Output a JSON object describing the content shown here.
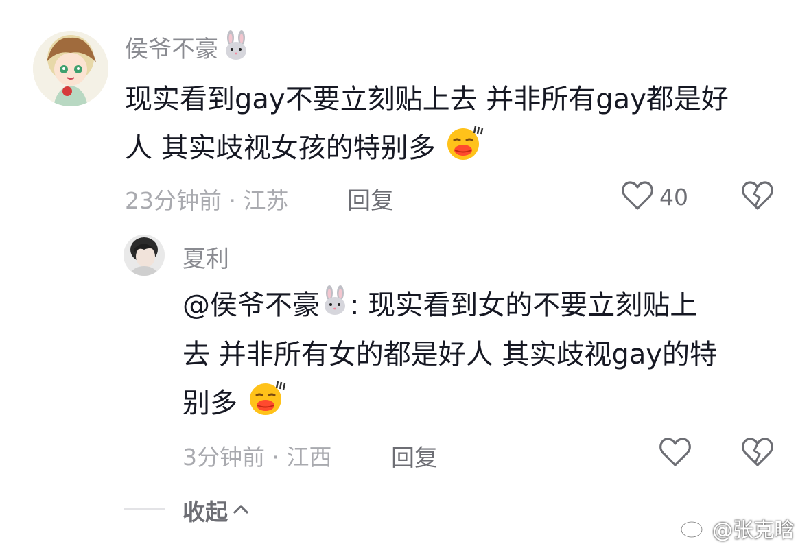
{
  "comment": {
    "username": "侯爷不豪",
    "username_emoji": "rabbit-emoji",
    "text_line1": "现实看到gay不要立刻贴上去 并非所有gay都是好",
    "text_line2": "人 其实歧视女孩的特别多",
    "text_emoji": "smirk-kiss-emoji",
    "time_location": "23分钟前 · 江苏",
    "reply_label": "回复",
    "like_count": "40"
  },
  "reply": {
    "username": "夏利",
    "mention": "@侯爷不豪",
    "mention_emoji": "rabbit-emoji",
    "text_line1_tail": ": 现实看到女的不要立刻贴上",
    "text_line2": "去 并非所有女的都是好人 其实歧视gay的特",
    "text_line3": "别多",
    "text_emoji": "smirk-kiss-emoji",
    "time_location": "3分钟前 · 江西",
    "reply_label": "回复"
  },
  "collapse_label": "收起",
  "watermark": "@张克晗",
  "colors": {
    "text_primary": "#161823",
    "text_secondary": "#8a8b91",
    "meta": "#a9aaaf",
    "emoji_yellow": "#ffc21a",
    "emoji_lips": "#ff4a2e"
  }
}
